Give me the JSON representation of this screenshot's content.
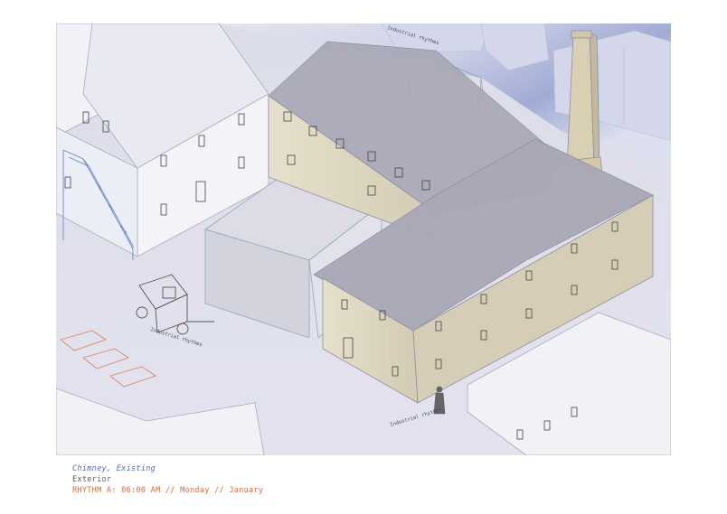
{
  "caption": {
    "title": "Chimney, Existing",
    "subtitle": "Exterior",
    "rhythm": "RHYTHM A: 06:00 AM // Monday // January"
  },
  "annotations": {
    "top": "Industrial rhythms",
    "cart": "Industrial rhythms",
    "figure": "Industrial rhythms"
  },
  "colors": {
    "background": "#dfe0ec",
    "sky_tint": "#8a98cc",
    "building_white": "#f3f3f8",
    "warehouse_wall": "#ddd6c2",
    "roof": "#a9a8b6",
    "chimney": "#d9cfb3",
    "stair": "#6f86c8",
    "caption_blue": "#5a6aa8",
    "caption_gray": "#5b5b68",
    "caption_orange": "#d66a3a"
  }
}
